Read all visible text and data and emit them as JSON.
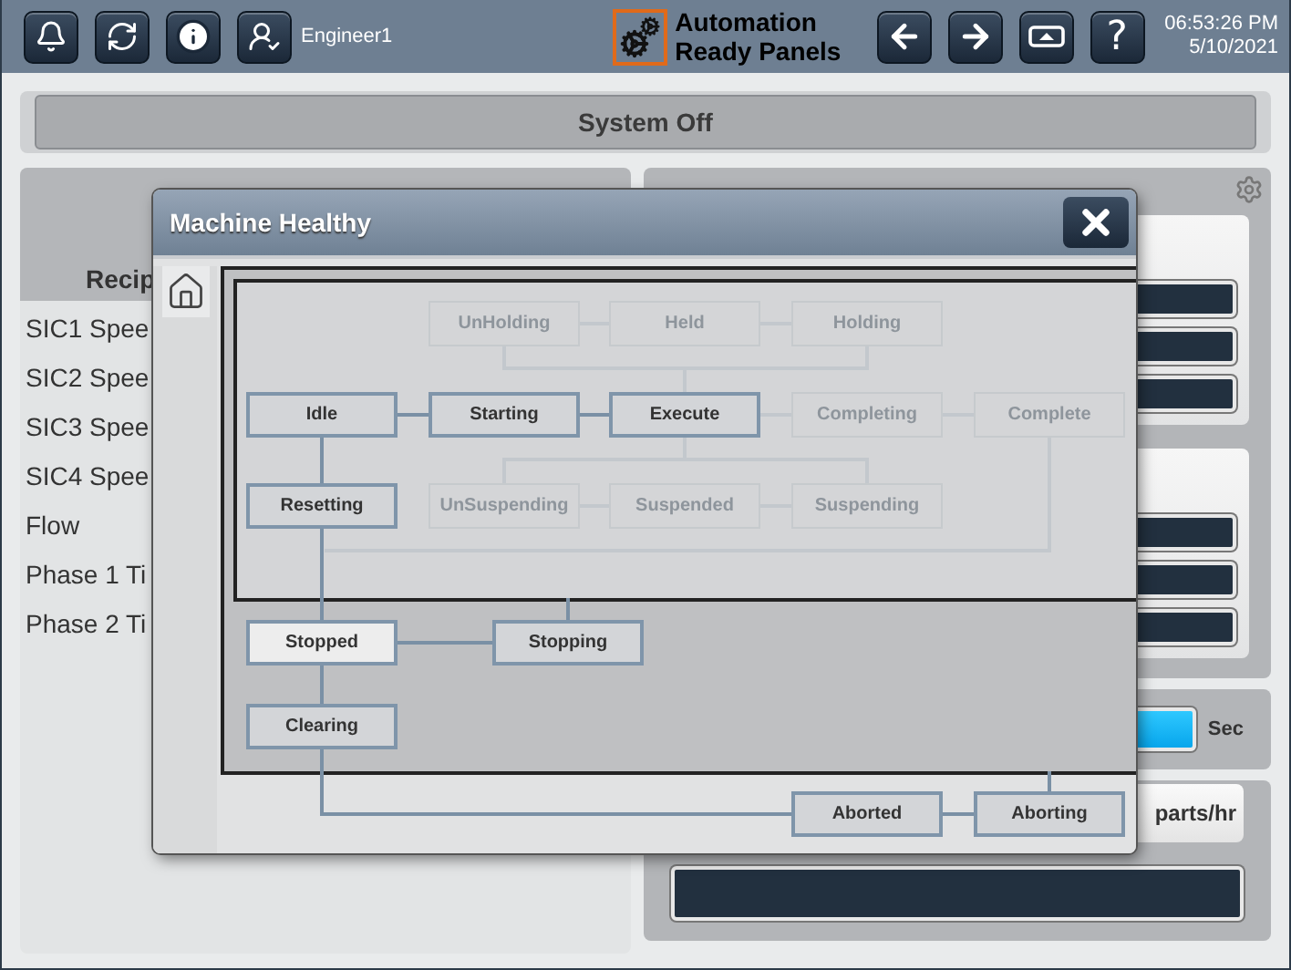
{
  "header": {
    "user": "Engineer1",
    "logo_lines": [
      "Automation",
      "Ready Panels"
    ],
    "help_key": "?",
    "time": "06:53:26 PM",
    "date": "5/10/2021"
  },
  "status_banner": "System Off",
  "recipe_panel": {
    "heading": "Recip",
    "items": [
      "SIC1 Spee",
      "SIC2 Spee",
      "SIC3 Spee",
      "SIC4 Spee",
      "Flow",
      "Phase 1 Ti",
      "Phase 2 Ti"
    ]
  },
  "production_panel": {
    "unit_label": "Sec",
    "rate_button": "parts/hr"
  },
  "dialog": {
    "title": "Machine Healthy",
    "states": [
      {
        "label": "UnHolding",
        "active": false,
        "selected": false
      },
      {
        "label": "Held",
        "active": false,
        "selected": false
      },
      {
        "label": "Holding",
        "active": false,
        "selected": false
      },
      {
        "label": "Idle",
        "active": true,
        "selected": false
      },
      {
        "label": "Starting",
        "active": true,
        "selected": false
      },
      {
        "label": "Execute",
        "active": true,
        "selected": false
      },
      {
        "label": "Completing",
        "active": false,
        "selected": false
      },
      {
        "label": "Complete",
        "active": false,
        "selected": false
      },
      {
        "label": "Resetting",
        "active": true,
        "selected": false
      },
      {
        "label": "UnSuspending",
        "active": false,
        "selected": false
      },
      {
        "label": "Suspended",
        "active": false,
        "selected": false
      },
      {
        "label": "Suspending",
        "active": false,
        "selected": false
      },
      {
        "label": "Stopped",
        "active": true,
        "selected": true
      },
      {
        "label": "Stopping",
        "active": true,
        "selected": false
      },
      {
        "label": "Clearing",
        "active": true,
        "selected": false
      },
      {
        "label": "Aborted",
        "active": true,
        "selected": false
      },
      {
        "label": "Aborting",
        "active": true,
        "selected": false
      }
    ]
  }
}
